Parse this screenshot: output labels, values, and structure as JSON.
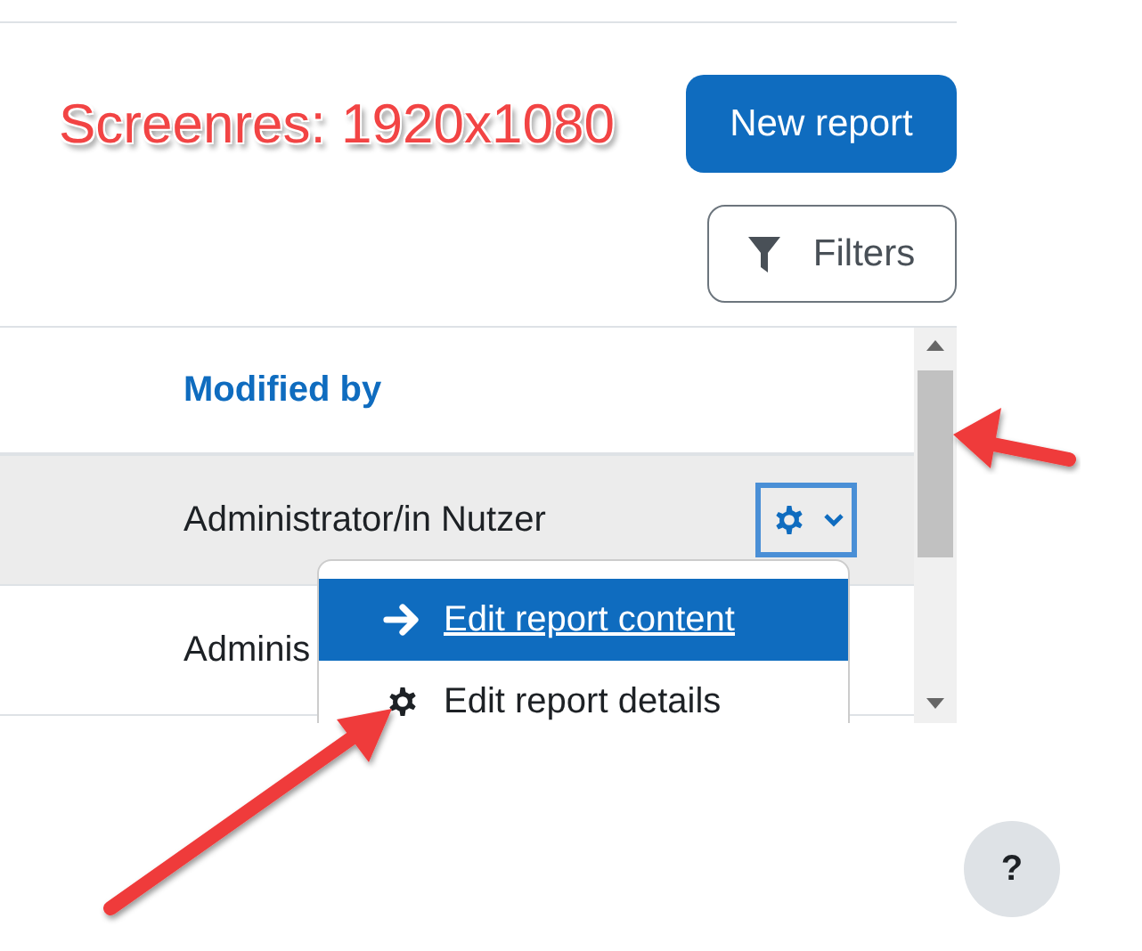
{
  "annotation": {
    "text": "Screenres: 1920x1080"
  },
  "actions": {
    "new_report": "New report",
    "filters": "Filters"
  },
  "table": {
    "columns": [
      {
        "label": "Modified by"
      }
    ],
    "rows": [
      {
        "modified_by": "Administrator/in Nutzer",
        "selected": true,
        "actions_expanded": true
      },
      {
        "modified_by": "Adminis",
        "selected": false,
        "actions_expanded": false
      }
    ]
  },
  "menu": {
    "items": [
      {
        "label": "Edit report content",
        "kind": "go",
        "selected": true
      },
      {
        "label": "Edit report details",
        "kind": "settings",
        "selected": false
      }
    ]
  },
  "help": {
    "label": "?"
  }
}
